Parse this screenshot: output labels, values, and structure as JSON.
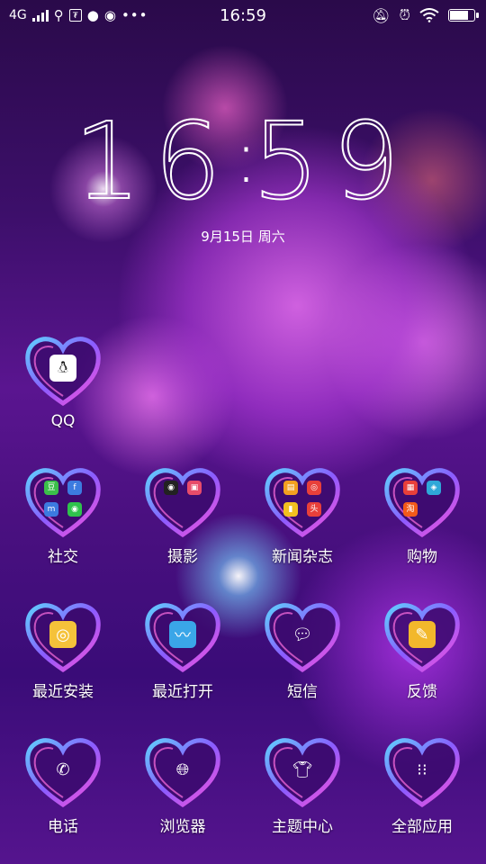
{
  "status_bar": {
    "network": "4G",
    "time": "16:59",
    "left_icons": [
      "usb-icon",
      "sim-toolkit-icon",
      "chat-bubble-icon",
      "wechat-icon",
      "more-dots-icon"
    ],
    "right_icons": [
      "mute-bell-icon",
      "alarm-icon",
      "wifi-icon",
      "battery-charging-icon"
    ]
  },
  "lock_clock": {
    "hours": "16",
    "minutes": "59",
    "date": "9月15日 周六"
  },
  "apps": [
    {
      "label": "QQ",
      "icon": "qq-penguin-icon"
    },
    {
      "label": "社交",
      "icon": "social-folder-icon"
    },
    {
      "label": "摄影",
      "icon": "photo-folder-icon"
    },
    {
      "label": "新闻杂志",
      "icon": "news-folder-icon"
    },
    {
      "label": "购物",
      "icon": "shopping-folder-icon"
    },
    {
      "label": "最近安装",
      "icon": "recent-install-icon"
    },
    {
      "label": "最近打开",
      "icon": "recent-open-icon"
    },
    {
      "label": "短信",
      "icon": "messages-icon"
    },
    {
      "label": "反馈",
      "icon": "feedback-icon"
    },
    {
      "label": "电话",
      "icon": "phone-icon"
    },
    {
      "label": "浏览器",
      "icon": "browser-globe-icon"
    },
    {
      "label": "主题中心",
      "icon": "theme-shirt-icon"
    },
    {
      "label": "全部应用",
      "icon": "all-apps-grid-icon"
    }
  ],
  "colors": {
    "heart_outer": "#7a5cff",
    "heart_inner": "#e05ad8",
    "accent": "#ff4fd8"
  }
}
